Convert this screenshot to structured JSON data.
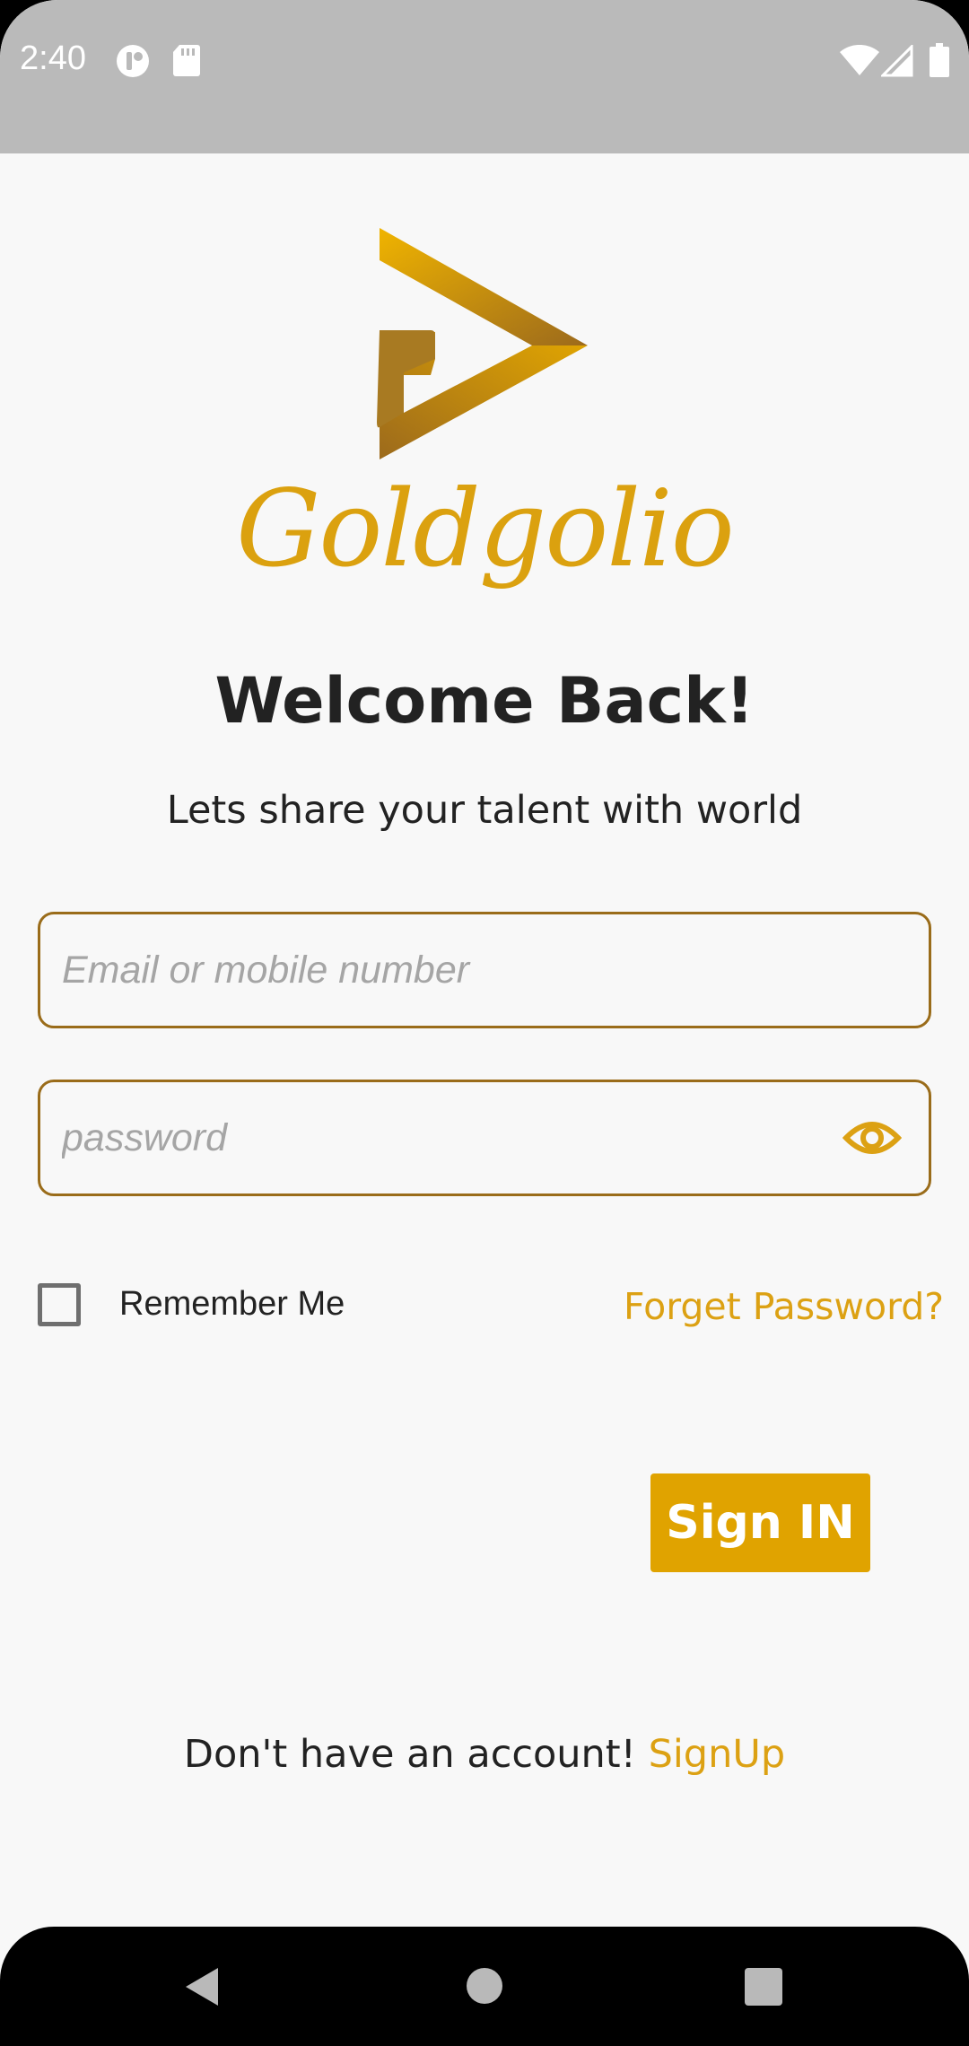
{
  "status_bar": {
    "time": "2:40",
    "icons": [
      "app-notification-icon",
      "sd-card-icon",
      "wifi-icon",
      "signal-icon",
      "battery-icon"
    ]
  },
  "logo": {
    "icon": "play-logo-icon",
    "brand_name": "Goldgolio"
  },
  "header": {
    "title": "Welcome Back!",
    "subtitle": "Lets share your talent with world"
  },
  "form": {
    "email_placeholder": "Email or mobile number",
    "email_value": "",
    "password_placeholder": "password",
    "password_value": "",
    "password_toggle_icon": "eye-icon",
    "remember_label": "Remember Me",
    "remember_checked": false,
    "forget_password": "Forget Password?",
    "signin_label": "Sign IN"
  },
  "footer": {
    "prompt": "Don't have an account!",
    "signup_label": "SignUp"
  },
  "colors": {
    "accent": "#e0a300",
    "border": "#9a6c1a",
    "status_bar": "#bababa"
  },
  "nav_bar": {
    "icons": [
      "back-icon",
      "home-icon",
      "recents-icon"
    ]
  }
}
